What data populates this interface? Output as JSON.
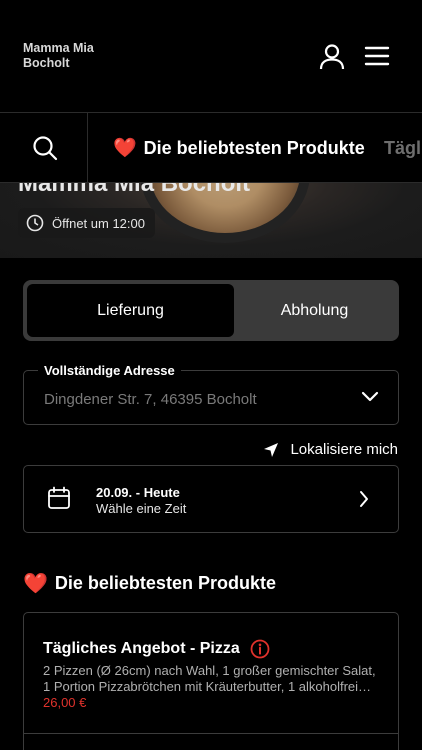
{
  "header": {
    "brand_line1": "Mamma Mia",
    "brand_line2": "Bocholt",
    "icons": [
      "user-icon",
      "hamburger-menu-icon"
    ]
  },
  "category_bar": {
    "search_icon": "search-icon",
    "active_tab": "Die beliebtesten Produkte",
    "active_tab_emoji": "❤️",
    "next_tab": "Tägli"
  },
  "hero": {
    "title": "Mamma Mia Bocholt",
    "opening_text": "Öffnet um 12:00"
  },
  "delivery_toggle": {
    "options": [
      "Lieferung",
      "Abholung"
    ],
    "selected": "Lieferung"
  },
  "address": {
    "label": "Vollständige Adresse",
    "value": "Dingdener Str. 7, 46395 Bocholt"
  },
  "locate": {
    "label": "Lokalisiere mich"
  },
  "date_picker": {
    "date": "20.09. - Heute",
    "hint": "Wähle eine Zeit"
  },
  "popular": {
    "title": "Die beliebtesten Produkte",
    "emoji": "❤️",
    "products": [
      {
        "name": "Tägliches Angebot - Pizza",
        "desc_line1": "2 Pizzen (Ø 26cm) nach Wahl, 1 großer gemischter Salat,",
        "desc_line2": "1 Portion Pizzabrötchen mit Kräuterbutter, 1 alkoholfrei…",
        "price": "26,00 €"
      }
    ]
  },
  "colors": {
    "background": "#000000",
    "price_red": "#e0322c",
    "toggle_bg": "#3a3a3a",
    "border": "#3c3c3c"
  }
}
